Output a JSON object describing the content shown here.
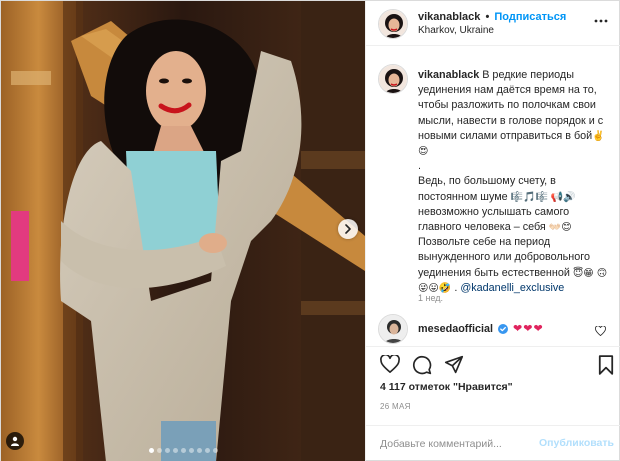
{
  "header": {
    "username": "vikanablack",
    "separator": "•",
    "follow_label": "Подписаться",
    "location": "Kharkov, Ukraine",
    "more_icon": "ellipsis-icon"
  },
  "caption": {
    "username": "vikanablack",
    "line1": "В редкие периоды уединения нам даётся время на то, чтобы разложить по полочкам свои мысли, навести в голове порядок и с новыми силами отправиться в бой",
    "line1_emoji": "✌️",
    "line2_emoji": "😍",
    "dot1": ".",
    "dot2": ".",
    "para2": "Ведь, по большому счету, в постоянном шуме",
    "para2_emoji": "🎼🎵🎼 📢🔊",
    "para2b": "невозможно услышать самого главного человека – себя",
    "para2b_emoji": "👐🏻😊",
    "para3": "Позвольте себе на период вынужденного или добровольного уединения быть естественной",
    "para3_emoji": "😇😁",
    "para3b_emoji": "🙃😜😛🤣",
    "mention_sep": ".",
    "mention": "@kadanelli_exclusive",
    "time": "1 нед."
  },
  "comment": {
    "username": "mesedaofficial",
    "hearts": "❤❤❤"
  },
  "actions": {
    "like_icon": "heart-icon",
    "comment_icon": "comment-icon",
    "share_icon": "share-icon",
    "save_icon": "bookmark-icon"
  },
  "likes": "4 117 отметок \"Нравится\"",
  "date": "26 МАЯ",
  "add_comment": {
    "placeholder": "Добавьте комментарий...",
    "post_label": "Опубликовать"
  },
  "carousel": {
    "slide_count": 9,
    "active_index": 0
  },
  "colors": {
    "link_blue": "#0095f6",
    "mention_blue": "#00376b",
    "muted": "#8e8e8e",
    "heart_red": "#e0245e",
    "post_disabled": "#b2dffc"
  }
}
